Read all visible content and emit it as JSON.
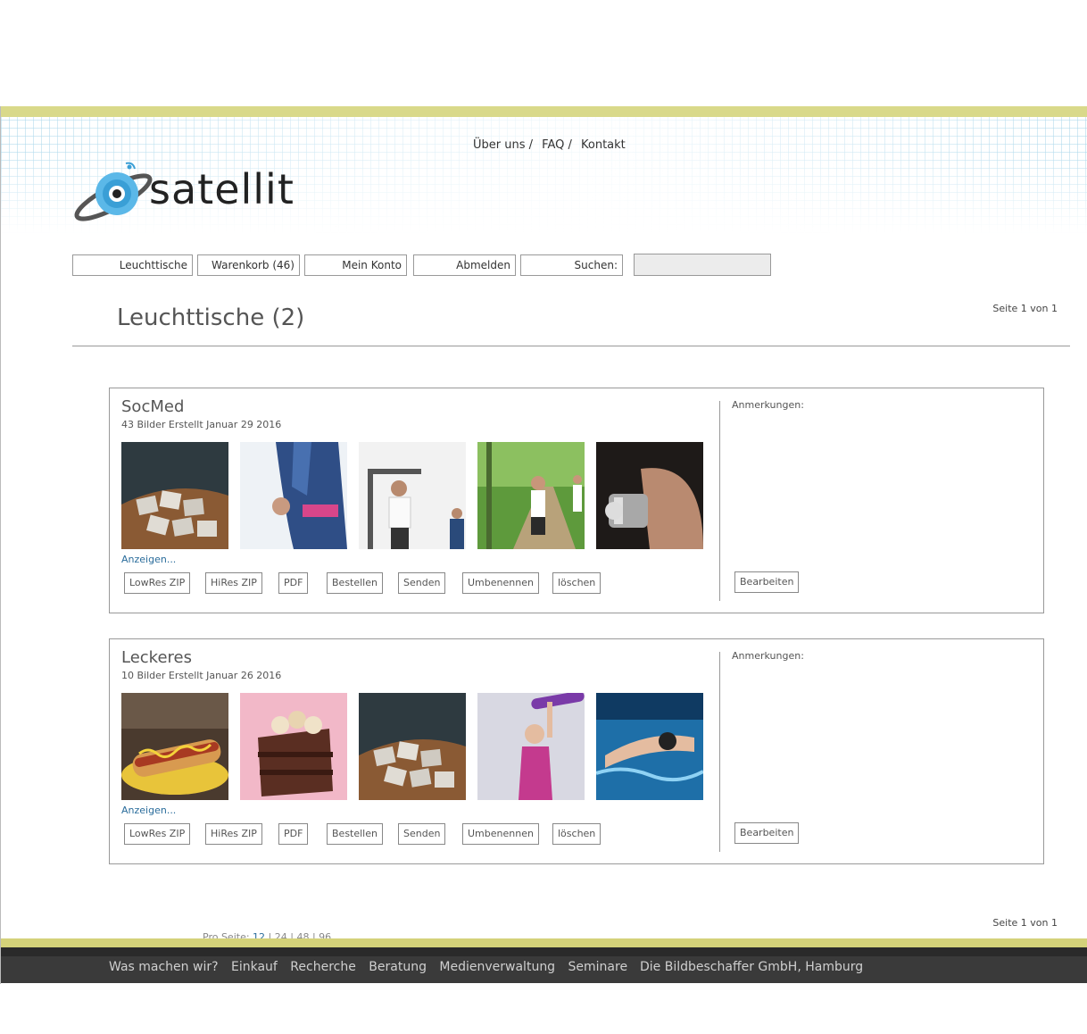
{
  "top_nav": {
    "about": "Über uns /",
    "faq": "FAQ /",
    "contact": "Kontakt"
  },
  "logo": {
    "text": "satellit"
  },
  "main_nav": {
    "lighttables": "Leuchttische",
    "cart": "Warenkorb (46)",
    "account": "Mein Konto",
    "logout": "Abmelden",
    "search_label": "Suchen:",
    "search_value": ""
  },
  "page": {
    "title": "Leuchttische (2)",
    "page_info_top": "Seite 1 von 1",
    "page_info_bottom": "Seite 1 von 1"
  },
  "lighttables": [
    {
      "name": "SocMed",
      "meta": "43 Bilder Erstellt Januar 29 2016",
      "thumbs": [
        "sugar-cubes-image",
        "jogger-arm-image",
        "gym-machine-image",
        "forest-run-image",
        "dumbbell-image"
      ],
      "show_link": "Anzeigen...",
      "notes_label": "Anmerkungen:",
      "edit_label": "Bearbeiten"
    },
    {
      "name": "Leckeres",
      "meta": "10 Bilder Erstellt Januar 26 2016",
      "thumbs": [
        "hotdog-image",
        "chocolate-cake-image",
        "sugar-cubes-image",
        "fitness-woman-image",
        "swimmer-image"
      ],
      "show_link": "Anzeigen...",
      "notes_label": "Anmerkungen:",
      "edit_label": "Bearbeiten"
    }
  ],
  "actions": {
    "lowres": "LowRes ZIP",
    "hires": "HiRes ZIP",
    "pdf": "PDF",
    "order": "Bestellen",
    "send": "Senden",
    "rename": "Umbenennen",
    "delete": "löschen"
  },
  "per_page": {
    "label": "Pro Seite:",
    "options": [
      "12",
      "24",
      "48",
      "96"
    ],
    "selected": "12"
  },
  "footer": {
    "links": [
      "Was machen wir?",
      "Einkauf",
      "Recherche",
      "Beratung",
      "Medienverwaltung",
      "Seminare"
    ],
    "company": "Die Bildbeschaffer GmbH, Hamburg"
  },
  "colors": {
    "accent_band": "#d9d98a",
    "footer_bg": "#3a3a3a",
    "link": "#2a6c9b"
  }
}
